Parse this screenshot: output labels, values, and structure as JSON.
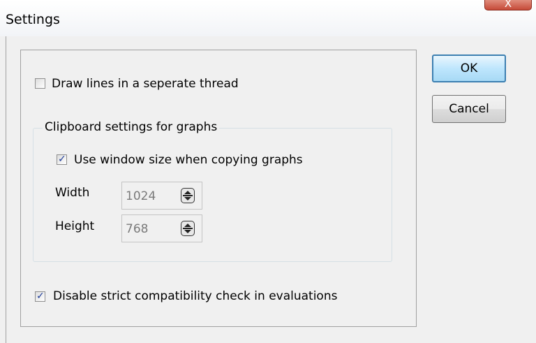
{
  "window": {
    "title": "Settings",
    "close_label": "X"
  },
  "options": {
    "draw_lines_label": "Draw lines in a seperate thread",
    "draw_lines_checked": false,
    "disable_strict_label": "Disable strict compatibility check in evaluations",
    "disable_strict_checked": true
  },
  "clipboard": {
    "group_title": "Clipboard settings for graphs",
    "use_window_size_label": "Use window size when copying graphs",
    "use_window_size_checked": true,
    "width_label": "Width",
    "width_value": "1024",
    "height_label": "Height",
    "height_value": "768"
  },
  "buttons": {
    "ok_label": "OK",
    "cancel_label": "Cancel"
  },
  "checkmark_glyph": "✓"
}
